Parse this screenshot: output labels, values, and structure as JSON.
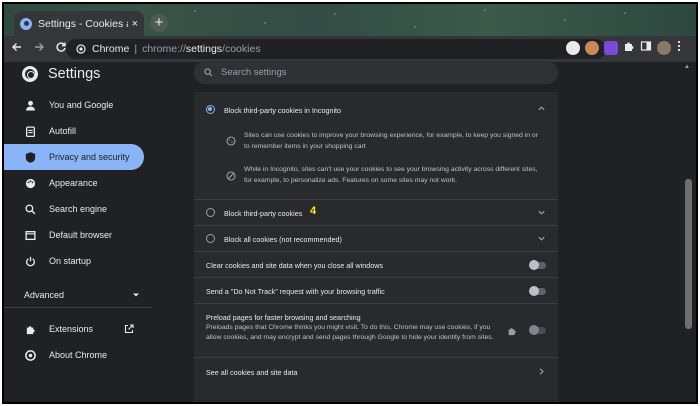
{
  "browser": {
    "tab_title": "Settings - Cookies and other sit",
    "tab_close": "×",
    "new_tab": "+",
    "site_name": "Chrome",
    "url_scheme": "chrome://",
    "url_host": "settings",
    "url_path": "/cookies"
  },
  "header": {
    "app_title": "Settings",
    "search_placeholder": "Search settings"
  },
  "sidebar": {
    "items": [
      {
        "label": "You and Google",
        "icon": "person-icon"
      },
      {
        "label": "Autofill",
        "icon": "clipboard-icon"
      },
      {
        "label": "Privacy and security",
        "icon": "shield-icon",
        "active": true
      },
      {
        "label": "Appearance",
        "icon": "palette-icon"
      },
      {
        "label": "Search engine",
        "icon": "search-icon"
      },
      {
        "label": "Default browser",
        "icon": "browser-window-icon"
      },
      {
        "label": "On startup",
        "icon": "power-icon"
      }
    ],
    "advanced_label": "Advanced",
    "extensions_label": "Extensions",
    "about_label": "About Chrome"
  },
  "content": {
    "block_incognito": {
      "label": "Block third-party cookies in Incognito",
      "selected": true,
      "detail_1": "Sites can use cookies to improve your browsing experience, for example, to keep you signed in or to remember items in your shopping cart",
      "detail_2": "While in Incognito, sites can't use your cookies to see your browsing activity across different sites, for example, to personalize ads. Features on some sites may not work."
    },
    "block_third_party": {
      "label": "Block third-party cookies",
      "annotation": "4"
    },
    "block_all": {
      "label": "Block all cookies (not recommended)"
    },
    "clear_on_close": {
      "label": "Clear cookies and site data when you close all windows",
      "enabled": false
    },
    "do_not_track": {
      "label": "Send a \"Do Not Track\" request with your browsing traffic",
      "enabled": false
    },
    "preload": {
      "label": "Preload pages for faster browsing and searching",
      "description": "Preloads pages that Chrome thinks you might visit. To do this, Chrome may use cookies, if you allow cookies, and may encrypt and send pages through Google to hide your identity from sites.",
      "enabled": false
    },
    "see_all": {
      "label": "See all cookies and site data"
    }
  },
  "colors": {
    "accent": "#8ab4f8",
    "background": "#202124",
    "card": "#292a2d",
    "annotation": "#f9f100"
  }
}
